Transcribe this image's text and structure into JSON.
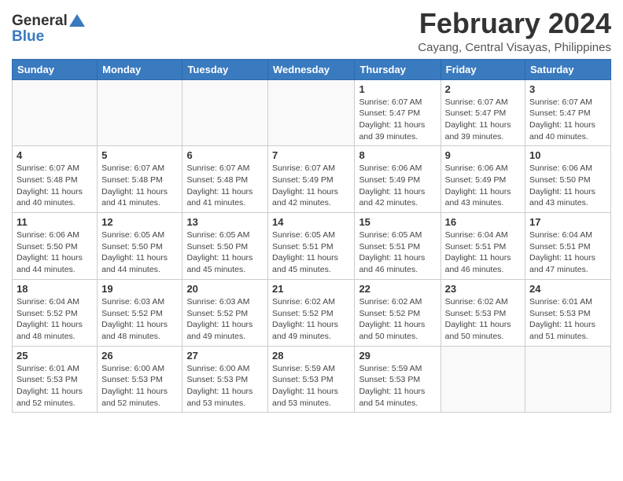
{
  "header": {
    "logo_general": "General",
    "logo_blue": "Blue",
    "month_title": "February 2024",
    "location": "Cayang, Central Visayas, Philippines"
  },
  "days_of_week": [
    "Sunday",
    "Monday",
    "Tuesday",
    "Wednesday",
    "Thursday",
    "Friday",
    "Saturday"
  ],
  "weeks": [
    [
      {
        "day": "",
        "info": ""
      },
      {
        "day": "",
        "info": ""
      },
      {
        "day": "",
        "info": ""
      },
      {
        "day": "",
        "info": ""
      },
      {
        "day": "1",
        "info": "Sunrise: 6:07 AM\nSunset: 5:47 PM\nDaylight: 11 hours and 39 minutes."
      },
      {
        "day": "2",
        "info": "Sunrise: 6:07 AM\nSunset: 5:47 PM\nDaylight: 11 hours and 39 minutes."
      },
      {
        "day": "3",
        "info": "Sunrise: 6:07 AM\nSunset: 5:47 PM\nDaylight: 11 hours and 40 minutes."
      }
    ],
    [
      {
        "day": "4",
        "info": "Sunrise: 6:07 AM\nSunset: 5:48 PM\nDaylight: 11 hours and 40 minutes."
      },
      {
        "day": "5",
        "info": "Sunrise: 6:07 AM\nSunset: 5:48 PM\nDaylight: 11 hours and 41 minutes."
      },
      {
        "day": "6",
        "info": "Sunrise: 6:07 AM\nSunset: 5:48 PM\nDaylight: 11 hours and 41 minutes."
      },
      {
        "day": "7",
        "info": "Sunrise: 6:07 AM\nSunset: 5:49 PM\nDaylight: 11 hours and 42 minutes."
      },
      {
        "day": "8",
        "info": "Sunrise: 6:06 AM\nSunset: 5:49 PM\nDaylight: 11 hours and 42 minutes."
      },
      {
        "day": "9",
        "info": "Sunrise: 6:06 AM\nSunset: 5:49 PM\nDaylight: 11 hours and 43 minutes."
      },
      {
        "day": "10",
        "info": "Sunrise: 6:06 AM\nSunset: 5:50 PM\nDaylight: 11 hours and 43 minutes."
      }
    ],
    [
      {
        "day": "11",
        "info": "Sunrise: 6:06 AM\nSunset: 5:50 PM\nDaylight: 11 hours and 44 minutes."
      },
      {
        "day": "12",
        "info": "Sunrise: 6:05 AM\nSunset: 5:50 PM\nDaylight: 11 hours and 44 minutes."
      },
      {
        "day": "13",
        "info": "Sunrise: 6:05 AM\nSunset: 5:50 PM\nDaylight: 11 hours and 45 minutes."
      },
      {
        "day": "14",
        "info": "Sunrise: 6:05 AM\nSunset: 5:51 PM\nDaylight: 11 hours and 45 minutes."
      },
      {
        "day": "15",
        "info": "Sunrise: 6:05 AM\nSunset: 5:51 PM\nDaylight: 11 hours and 46 minutes."
      },
      {
        "day": "16",
        "info": "Sunrise: 6:04 AM\nSunset: 5:51 PM\nDaylight: 11 hours and 46 minutes."
      },
      {
        "day": "17",
        "info": "Sunrise: 6:04 AM\nSunset: 5:51 PM\nDaylight: 11 hours and 47 minutes."
      }
    ],
    [
      {
        "day": "18",
        "info": "Sunrise: 6:04 AM\nSunset: 5:52 PM\nDaylight: 11 hours and 48 minutes."
      },
      {
        "day": "19",
        "info": "Sunrise: 6:03 AM\nSunset: 5:52 PM\nDaylight: 11 hours and 48 minutes."
      },
      {
        "day": "20",
        "info": "Sunrise: 6:03 AM\nSunset: 5:52 PM\nDaylight: 11 hours and 49 minutes."
      },
      {
        "day": "21",
        "info": "Sunrise: 6:02 AM\nSunset: 5:52 PM\nDaylight: 11 hours and 49 minutes."
      },
      {
        "day": "22",
        "info": "Sunrise: 6:02 AM\nSunset: 5:52 PM\nDaylight: 11 hours and 50 minutes."
      },
      {
        "day": "23",
        "info": "Sunrise: 6:02 AM\nSunset: 5:53 PM\nDaylight: 11 hours and 50 minutes."
      },
      {
        "day": "24",
        "info": "Sunrise: 6:01 AM\nSunset: 5:53 PM\nDaylight: 11 hours and 51 minutes."
      }
    ],
    [
      {
        "day": "25",
        "info": "Sunrise: 6:01 AM\nSunset: 5:53 PM\nDaylight: 11 hours and 52 minutes."
      },
      {
        "day": "26",
        "info": "Sunrise: 6:00 AM\nSunset: 5:53 PM\nDaylight: 11 hours and 52 minutes."
      },
      {
        "day": "27",
        "info": "Sunrise: 6:00 AM\nSunset: 5:53 PM\nDaylight: 11 hours and 53 minutes."
      },
      {
        "day": "28",
        "info": "Sunrise: 5:59 AM\nSunset: 5:53 PM\nDaylight: 11 hours and 53 minutes."
      },
      {
        "day": "29",
        "info": "Sunrise: 5:59 AM\nSunset: 5:53 PM\nDaylight: 11 hours and 54 minutes."
      },
      {
        "day": "",
        "info": ""
      },
      {
        "day": "",
        "info": ""
      }
    ]
  ]
}
